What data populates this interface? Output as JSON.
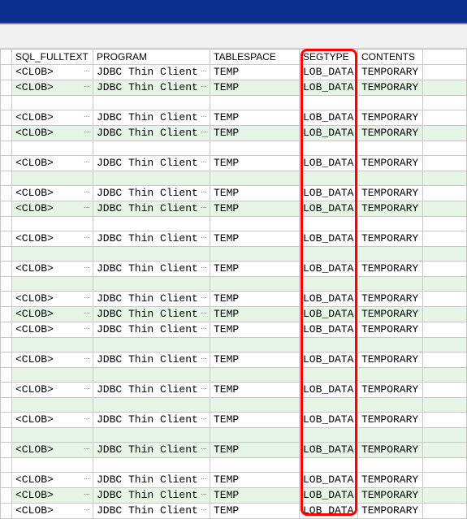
{
  "columns": {
    "sql_fulltext": "SQL_FULLTEXT",
    "program": "PROGRAM",
    "tablespace": "TABLESPACE",
    "segtype": "SEGTYPE",
    "contents": "CONTENTS"
  },
  "cell_placeholder": "",
  "rows": [
    {
      "sql": "<CLOB>",
      "prog": "JDBC Thin Client",
      "ts": "TEMP",
      "seg": "LOB_DATA",
      "cont": "TEMPORARY",
      "cls": "white",
      "blank": false
    },
    {
      "sql": "<CLOB>",
      "prog": "JDBC Thin Client",
      "ts": "TEMP",
      "seg": "LOB_DATA",
      "cont": "TEMPORARY",
      "cls": "green",
      "blank": false
    },
    {
      "sql": "",
      "prog": "",
      "ts": "",
      "seg": "",
      "cont": "",
      "cls": "white",
      "blank": true
    },
    {
      "sql": "<CLOB>",
      "prog": "JDBC Thin Client",
      "ts": "TEMP",
      "seg": "LOB_DATA",
      "cont": "TEMPORARY",
      "cls": "white",
      "blank": false
    },
    {
      "sql": "<CLOB>",
      "prog": "JDBC Thin Client",
      "ts": "TEMP",
      "seg": "LOB_DATA",
      "cont": "TEMPORARY",
      "cls": "green",
      "blank": false
    },
    {
      "sql": "",
      "prog": "",
      "ts": "",
      "seg": "",
      "cont": "",
      "cls": "white",
      "blank": true
    },
    {
      "sql": "<CLOB>",
      "prog": "JDBC Thin Client",
      "ts": "TEMP",
      "seg": "LOB_DATA",
      "cont": "TEMPORARY",
      "cls": "white",
      "blank": false
    },
    {
      "sql": "",
      "prog": "",
      "ts": "",
      "seg": "",
      "cont": "",
      "cls": "green",
      "blank": true
    },
    {
      "sql": "<CLOB>",
      "prog": "JDBC Thin Client",
      "ts": "TEMP",
      "seg": "LOB_DATA",
      "cont": "TEMPORARY",
      "cls": "white",
      "blank": false
    },
    {
      "sql": "<CLOB>",
      "prog": "JDBC Thin Client",
      "ts": "TEMP",
      "seg": "LOB_DATA",
      "cont": "TEMPORARY",
      "cls": "green",
      "blank": false
    },
    {
      "sql": "",
      "prog": "",
      "ts": "",
      "seg": "",
      "cont": "",
      "cls": "white",
      "blank": true
    },
    {
      "sql": "<CLOB>",
      "prog": "JDBC Thin Client",
      "ts": "TEMP",
      "seg": "LOB_DATA",
      "cont": "TEMPORARY",
      "cls": "white",
      "blank": false
    },
    {
      "sql": "",
      "prog": "",
      "ts": "",
      "seg": "",
      "cont": "",
      "cls": "green",
      "blank": true
    },
    {
      "sql": "<CLOB>",
      "prog": "JDBC Thin Client",
      "ts": "TEMP",
      "seg": "LOB_DATA",
      "cont": "TEMPORARY",
      "cls": "white",
      "blank": false
    },
    {
      "sql": "",
      "prog": "",
      "ts": "",
      "seg": "",
      "cont": "",
      "cls": "green",
      "blank": true
    },
    {
      "sql": "<CLOB>",
      "prog": "JDBC Thin Client",
      "ts": "TEMP",
      "seg": "LOB_DATA",
      "cont": "TEMPORARY",
      "cls": "white",
      "blank": false
    },
    {
      "sql": "<CLOB>",
      "prog": "JDBC Thin Client",
      "ts": "TEMP",
      "seg": "LOB_DATA",
      "cont": "TEMPORARY",
      "cls": "green",
      "blank": false
    },
    {
      "sql": "<CLOB>",
      "prog": "JDBC Thin Client",
      "ts": "TEMP",
      "seg": "LOB_DATA",
      "cont": "TEMPORARY",
      "cls": "white",
      "blank": false
    },
    {
      "sql": "",
      "prog": "",
      "ts": "",
      "seg": "",
      "cont": "",
      "cls": "green",
      "blank": true
    },
    {
      "sql": "<CLOB>",
      "prog": "JDBC Thin Client",
      "ts": "TEMP",
      "seg": "LOB_DATA",
      "cont": "TEMPORARY",
      "cls": "white",
      "blank": false
    },
    {
      "sql": "",
      "prog": "",
      "ts": "",
      "seg": "",
      "cont": "",
      "cls": "green",
      "blank": true
    },
    {
      "sql": "<CLOB>",
      "prog": "JDBC Thin Client",
      "ts": "TEMP",
      "seg": "LOB_DATA",
      "cont": "TEMPORARY",
      "cls": "white",
      "blank": false
    },
    {
      "sql": "",
      "prog": "",
      "ts": "",
      "seg": "",
      "cont": "",
      "cls": "green",
      "blank": true
    },
    {
      "sql": "<CLOB>",
      "prog": "JDBC Thin Client",
      "ts": "TEMP",
      "seg": "LOB_DATA",
      "cont": "TEMPORARY",
      "cls": "white",
      "blank": false
    },
    {
      "sql": "",
      "prog": "",
      "ts": "",
      "seg": "",
      "cont": "",
      "cls": "green",
      "blank": true
    },
    {
      "sql": "<CLOB>",
      "prog": "JDBC Thin Client",
      "ts": "TEMP",
      "seg": "LOB_DATA",
      "cont": "TEMPORARY",
      "cls": "green",
      "blank": false
    },
    {
      "sql": "",
      "prog": "",
      "ts": "",
      "seg": "",
      "cont": "",
      "cls": "white",
      "blank": true
    },
    {
      "sql": "<CLOB>",
      "prog": "JDBC Thin Client",
      "ts": "TEMP",
      "seg": "LOB_DATA",
      "cont": "TEMPORARY",
      "cls": "white",
      "blank": false
    },
    {
      "sql": "<CLOB>",
      "prog": "JDBC Thin Client",
      "ts": "TEMP",
      "seg": "LOB_DATA",
      "cont": "TEMPORARY",
      "cls": "green",
      "blank": false
    },
    {
      "sql": "<CLOB>",
      "prog": "JDBC Thin Client",
      "ts": "TEMP",
      "seg": "LOB_DATA",
      "cont": "TEMPORARY",
      "cls": "white",
      "blank": false
    }
  ]
}
